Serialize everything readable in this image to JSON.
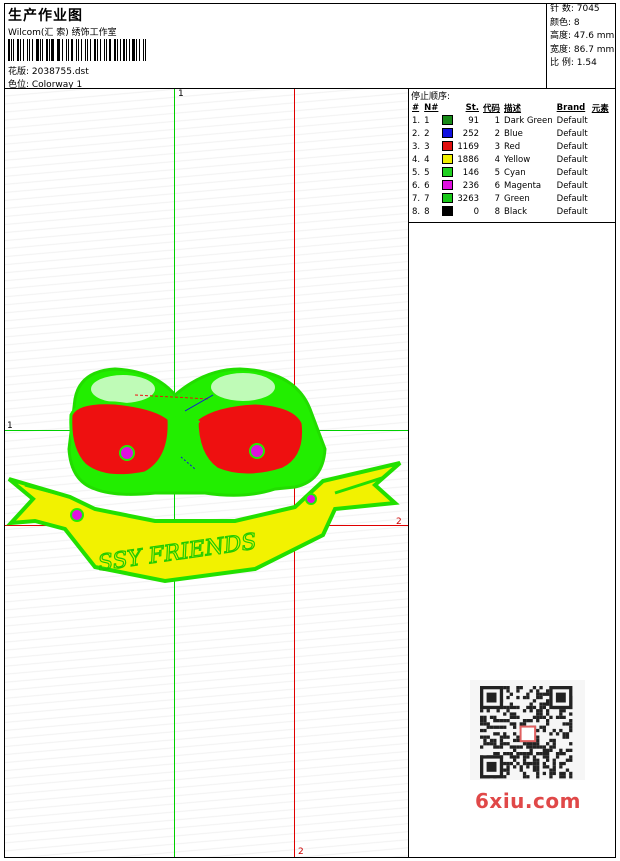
{
  "header": {
    "title": "生产作业图",
    "company": "Wilcom(汇 索) 绣饰工作室",
    "design": "花版: 2038755.dst",
    "colorway": "色位: Colorway 1"
  },
  "stats": {
    "stitches": "针 数: 7045",
    "colors": "颜色: 8",
    "height": "高度: 47.6 mm",
    "width": "宽度: 86.7 mm",
    "scale": "比 例: 1.54"
  },
  "sequence": {
    "label": "停止顺序:",
    "headers": [
      "#",
      "N#",
      "St.",
      "代码",
      "描述",
      "Brand",
      "元素"
    ],
    "rows": [
      {
        "idx": "1.",
        "n": "1",
        "color": "#188a18",
        "st": "91",
        "code": "1",
        "desc": "Dark Green",
        "brand": "Default"
      },
      {
        "idx": "2.",
        "n": "2",
        "color": "#1010e0",
        "st": "252",
        "code": "2",
        "desc": "Blue",
        "brand": "Default"
      },
      {
        "idx": "3.",
        "n": "3",
        "color": "#e01010",
        "st": "1169",
        "code": "3",
        "desc": "Red",
        "brand": "Default"
      },
      {
        "idx": "4.",
        "n": "4",
        "color": "#f0f000",
        "st": "1886",
        "code": "4",
        "desc": "Yellow",
        "brand": "Default"
      },
      {
        "idx": "5.",
        "n": "5",
        "color": "#20d020",
        "st": "146",
        "code": "5",
        "desc": "Cyan",
        "brand": "Default"
      },
      {
        "idx": "6.",
        "n": "6",
        "color": "#e010e0",
        "st": "236",
        "code": "6",
        "desc": "Magenta",
        "brand": "Default"
      },
      {
        "idx": "7.",
        "n": "7",
        "color": "#18c818",
        "st": "3263",
        "code": "7",
        "desc": "Green",
        "brand": "Default"
      },
      {
        "idx": "8.",
        "n": "8",
        "color": "#000000",
        "st": "0",
        "code": "8",
        "desc": "Black",
        "brand": "Default"
      }
    ]
  },
  "guides": {
    "green_label_top": "1",
    "green_label_left": "1",
    "red_label_right": "2",
    "red_label_bottom": "2"
  },
  "design_text": "SSY FRIENDS",
  "watermark": "6xiu.com"
}
